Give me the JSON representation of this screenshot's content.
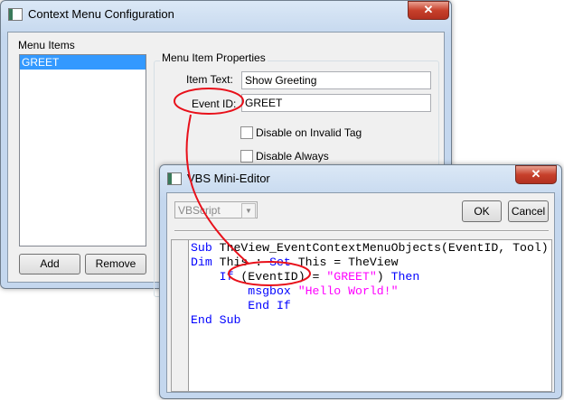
{
  "main_window": {
    "title": "Context Menu Configuration",
    "close": "✕",
    "menu_items_label": "Menu Items",
    "menu_items": [
      "GREET"
    ],
    "add_label": "Add",
    "remove_label": "Remove",
    "group_label": "Menu Item Properties",
    "item_text_label": "Item Text:",
    "item_text_value": "Show Greeting",
    "event_id_label": "Event ID:",
    "event_id_value": "GREET",
    "disable_invalid_label": "Disable on Invalid Tag",
    "disable_always_label": "Disable Always"
  },
  "editor": {
    "title": "VBS Mini-Editor",
    "close": "✕",
    "language": "VBScript",
    "ok_label": "OK",
    "cancel_label": "Cancel",
    "code": {
      "l1a": "Sub",
      "l1b": " TheView_EventContextMenuObjects(EventID, Tool)",
      "l2a": "Dim",
      "l2b": " This : ",
      "l2c": "Set",
      "l2d": " This = TheView",
      "l3a": "    If",
      "l3b": " (EventID) = ",
      "l3c": "\"GREET\"",
      "l3d": ") ",
      "l3e": "Then",
      "l4a": "        msgbox ",
      "l4b": "\"Hello World!\"",
      "l5a": "        End If",
      "l6a": "End Sub"
    }
  },
  "colors": {
    "annotation": "#e8101a",
    "keyword": "#0000ff",
    "string": "#ff00ff"
  }
}
